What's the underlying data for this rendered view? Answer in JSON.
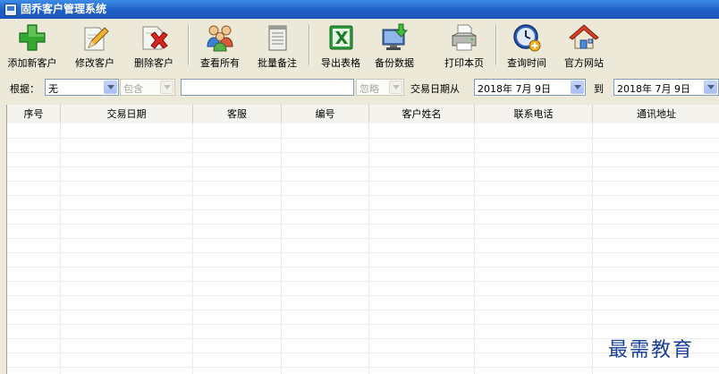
{
  "window": {
    "title": "固乔客户管理系统"
  },
  "toolbar": {
    "buttons": [
      {
        "label": "添加新客户",
        "icon": "add-plus-icon"
      },
      {
        "label": "修改客户",
        "icon": "edit-pencil-icon"
      },
      {
        "label": "删除客户",
        "icon": "delete-x-icon"
      },
      {
        "label": "查看所有",
        "icon": "users-group-icon"
      },
      {
        "label": "批量备注",
        "icon": "notepad-icon"
      },
      {
        "label": "导出表格",
        "icon": "excel-icon"
      },
      {
        "label": "备份数据",
        "icon": "backup-monitor-icon"
      },
      {
        "label": "打印本页",
        "icon": "printer-icon"
      },
      {
        "label": "查询时间",
        "icon": "clock-icon"
      },
      {
        "label": "官方网站",
        "icon": "home-icon"
      }
    ]
  },
  "filter": {
    "by_label": "根据：",
    "field_value": "无",
    "match_value": "包含",
    "keyword_value": "",
    "date_mode_value": "忽略",
    "date_from_label": "交易日期从",
    "date_from_value": "2018年 7月 9日",
    "to_label": "到",
    "date_to_value": "2018年 7月 9日"
  },
  "table": {
    "columns": [
      "序号",
      "交易日期",
      "客服",
      "编号",
      "客户姓名",
      "联系电话",
      "通讯地址"
    ],
    "rows": []
  },
  "watermark": {
    "text": "最需教育"
  }
}
